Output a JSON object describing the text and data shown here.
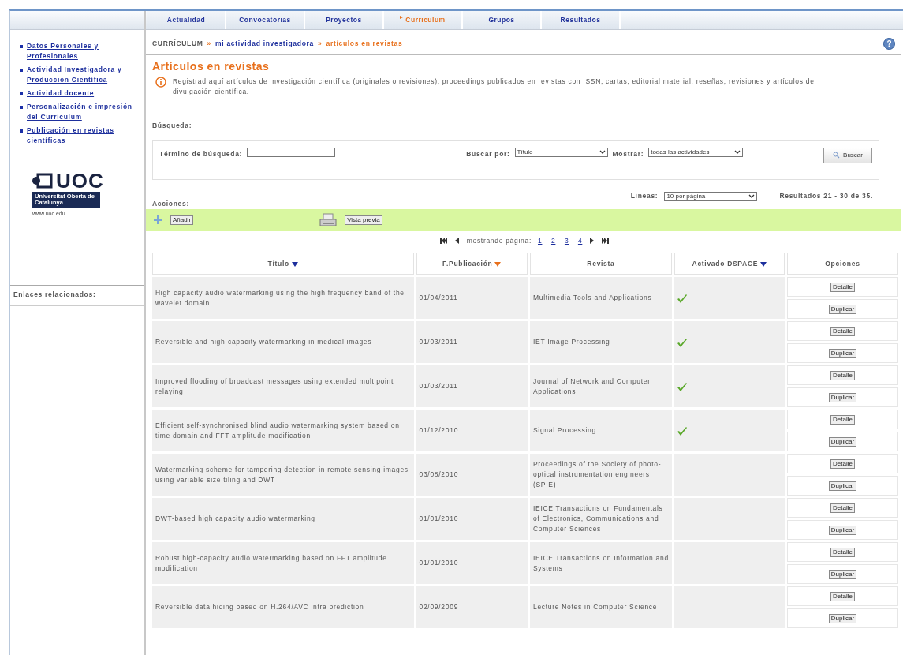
{
  "tabs": [
    {
      "label": "Actualidad",
      "selected": false
    },
    {
      "label": "Convocatorias",
      "selected": false
    },
    {
      "label": "Proyectos",
      "selected": false
    },
    {
      "label": "Curriculum",
      "selected": true
    },
    {
      "label": "Grupos",
      "selected": false
    },
    {
      "label": "Resultados",
      "selected": false
    }
  ],
  "sidebar": {
    "links": [
      "Datos Personales y Profesionales",
      "Actividad Investigadora y Producción Científica",
      "Actividad docente",
      "Personalización e impresión del Currículum",
      "Publicación en revistas científicas"
    ],
    "logo": {
      "name": "UOC",
      "subtitle": "Universitat Oberta de Catalunya",
      "url": "www.uoc.edu"
    },
    "related_title": "Enlaces relacionados:"
  },
  "breadcrumb": {
    "separator": "»",
    "items": [
      {
        "label": "CURRÍCULUM",
        "kind": "root"
      },
      {
        "label": "mi actividad investigadora",
        "kind": "link"
      },
      {
        "label": "artículos en revistas",
        "kind": "current"
      }
    ]
  },
  "help": "?",
  "title": "Artículos en revistas",
  "description": "Registrad aquí artículos de investigación científica (originales o revisiones), proceedings publicados en revistas con ISSN, cartas, editorial material, reseñas, revisiones y artículos de divulgación científica.",
  "search": {
    "section_label": "Búsqueda:",
    "term_label": "Término de búsqueda:",
    "by_label": "Buscar por:",
    "by_value": "Título",
    "show_label": "Mostrar:",
    "show_value": "todas las actividades",
    "button": "Buscar"
  },
  "lines": {
    "label": "Líneas:",
    "value": "10 por página"
  },
  "results": "Resultados 21 - 30 de 35.",
  "actions": {
    "label": "Acciones:",
    "add": "Añadir",
    "preview": "Vista previa"
  },
  "pager": {
    "label": "mostrando página:",
    "separator": "-",
    "pages": [
      "1",
      "2",
      "3",
      "4"
    ]
  },
  "table": {
    "columns": [
      {
        "label": "Título",
        "sortable": true,
        "sorted": false
      },
      {
        "label": "F.Publicación",
        "sortable": true,
        "sorted": true
      },
      {
        "label": "Revista",
        "sortable": false,
        "sorted": false
      },
      {
        "label": "Activado DSPACE",
        "sortable": true,
        "sorted": false
      },
      {
        "label": "Opciones",
        "sortable": false,
        "sorted": false
      }
    ],
    "rows": [
      {
        "title": "High capacity audio watermarking using the high frequency band of the wavelet domain",
        "date": "01/04/2011",
        "journal": "Multimedia Tools and Applications",
        "dspace": true,
        "buttons": [
          "Detalle",
          "Duplicar"
        ]
      },
      {
        "title": "Reversible and high-capacity watermarking in medical images",
        "date": "01/03/2011",
        "journal": "IET Image Processing",
        "dspace": true,
        "buttons": [
          "Detalle",
          "Duplicar"
        ]
      },
      {
        "title": "Improved flooding of broadcast messages using extended multipoint relaying",
        "date": "01/03/2011",
        "journal": "Journal of Network and Computer Applications",
        "dspace": true,
        "buttons": [
          "Detalle",
          "Duplicar"
        ]
      },
      {
        "title": "Efficient self-synchronised blind audio watermarking system based on time domain and FFT amplitude modification",
        "date": "01/12/2010",
        "journal": "Signal Processing",
        "dspace": true,
        "buttons": [
          "Detalle",
          "Duplicar"
        ]
      },
      {
        "title": "Watermarking scheme for tampering detection in remote sensing images using variable size tiling and DWT",
        "date": "03/08/2010",
        "journal": "Proceedings of the Society of photo-optical instrumentation engineers (SPIE)",
        "dspace": false,
        "buttons": [
          "Detalle",
          "Duplicar"
        ]
      },
      {
        "title": "DWT-based high capacity audio watermarking",
        "date": "01/01/2010",
        "journal": "IEICE Transactions on Fundamentals of Electronics, Communications and Computer Sciences",
        "dspace": false,
        "buttons": [
          "Detalle",
          "Duplicar"
        ]
      },
      {
        "title": "Robust high-capacity audio watermarking based on FFT amplitude modification",
        "date": "01/01/2010",
        "journal": "IEICE Transactions on Information and Systems",
        "dspace": false,
        "buttons": [
          "Detalle",
          "Duplicar"
        ]
      },
      {
        "title": "Reversible data hiding based on H.264/AVC intra prediction",
        "date": "02/09/2009",
        "journal": "Lecture Notes in Computer Science",
        "dspace": false,
        "buttons": [
          "Detalle",
          "Duplicar"
        ]
      }
    ]
  }
}
